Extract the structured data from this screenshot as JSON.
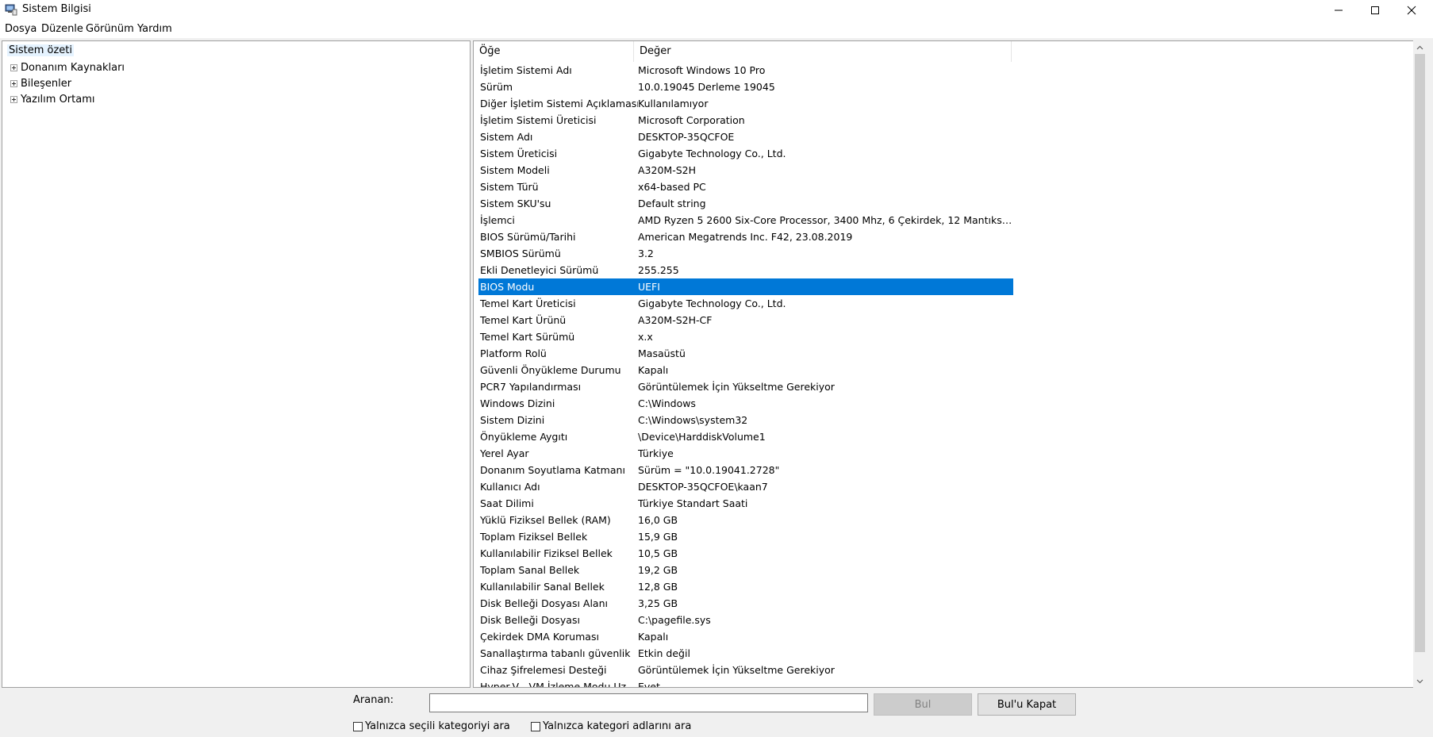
{
  "window": {
    "title": "Sistem Bilgisi",
    "icons": {
      "app": "system-info-icon",
      "minimize": "minimize-icon",
      "maximize": "maximize-icon",
      "close": "close-icon"
    }
  },
  "menu": [
    "Dosya",
    "Düzenle",
    "Görünüm",
    "Yardım"
  ],
  "tree": {
    "root": "Sistem özeti",
    "nodes": [
      "Donanım Kaynakları",
      "Bileşenler",
      "Yazılım Ortamı"
    ]
  },
  "list": {
    "columns": [
      "Öğe",
      "Değer"
    ],
    "selected_index": 13,
    "selection_color": "#0078d7",
    "rows": [
      [
        "İşletim Sistemi Adı",
        "Microsoft Windows 10 Pro"
      ],
      [
        "Sürüm",
        "10.0.19045 Derleme 19045"
      ],
      [
        "Diğer İşletim Sistemi Açıklaması",
        "Kullanılamıyor"
      ],
      [
        "İşletim Sistemi Üreticisi",
        "Microsoft Corporation"
      ],
      [
        "Sistem Adı",
        "DESKTOP-35QCFOE"
      ],
      [
        "Sistem Üreticisi",
        "Gigabyte Technology Co., Ltd."
      ],
      [
        "Sistem Modeli",
        "A320M-S2H"
      ],
      [
        "Sistem Türü",
        "x64-based PC"
      ],
      [
        "Sistem SKU'su",
        "Default string"
      ],
      [
        "İşlemci",
        "AMD Ryzen 5 2600 Six-Core Processor, 3400 Mhz, 6 Çekirdek, 12 Mantıksal İşl..."
      ],
      [
        "BIOS Sürümü/Tarihi",
        "American Megatrends Inc. F42, 23.08.2019"
      ],
      [
        "SMBIOS Sürümü",
        "3.2"
      ],
      [
        "Ekli Denetleyici Sürümü",
        "255.255"
      ],
      [
        "BIOS Modu",
        "UEFI"
      ],
      [
        "Temel Kart Üreticisi",
        "Gigabyte Technology Co., Ltd."
      ],
      [
        "Temel Kart Ürünü",
        "A320M-S2H-CF"
      ],
      [
        "Temel Kart Sürümü",
        "x.x"
      ],
      [
        "Platform Rolü",
        "Masaüstü"
      ],
      [
        "Güvenli Önyükleme Durumu",
        "Kapalı"
      ],
      [
        "PCR7 Yapılandırması",
        "Görüntülemek İçin Yükseltme Gerekiyor"
      ],
      [
        "Windows Dizini",
        "C:\\Windows"
      ],
      [
        "Sistem Dizini",
        "C:\\Windows\\system32"
      ],
      [
        "Önyükleme Aygıtı",
        "\\Device\\HarddiskVolume1"
      ],
      [
        "Yerel Ayar",
        "Türkiye"
      ],
      [
        "Donanım Soyutlama Katmanı",
        "Sürüm = \"10.0.19041.2728\""
      ],
      [
        "Kullanıcı Adı",
        "DESKTOP-35QCFOE\\kaan7"
      ],
      [
        "Saat Dilimi",
        "Türkiye Standart Saati"
      ],
      [
        "Yüklü Fiziksel Bellek (RAM)",
        "16,0 GB"
      ],
      [
        "Toplam Fiziksel Bellek",
        "15,9 GB"
      ],
      [
        "Kullanılabilir Fiziksel Bellek",
        "10,5 GB"
      ],
      [
        "Toplam Sanal Bellek",
        "19,2 GB"
      ],
      [
        "Kullanılabilir Sanal Bellek",
        "12,8 GB"
      ],
      [
        "Disk Belleği Dosyası Alanı",
        "3,25 GB"
      ],
      [
        "Disk Belleği Dosyası",
        "C:\\pagefile.sys"
      ],
      [
        "Çekirdek DMA Koruması",
        "Kapalı"
      ],
      [
        "Sanallaştırma tabanlı güvenlik",
        "Etkin değil"
      ],
      [
        "Cihaz Şifrelemesi Desteği",
        "Görüntülemek İçin Yükseltme Gerekiyor"
      ],
      [
        "Hyper-V - VM İzleme Modu Uz...",
        "Evet"
      ]
    ]
  },
  "find": {
    "label": "Aranan:",
    "value": "",
    "find_button": "Bul",
    "close_button": "Bul'u Kapat",
    "check_selected_category": "Yalnızca seçili kategoriyi ara",
    "check_category_names": "Yalnızca kategori adlarını ara"
  }
}
